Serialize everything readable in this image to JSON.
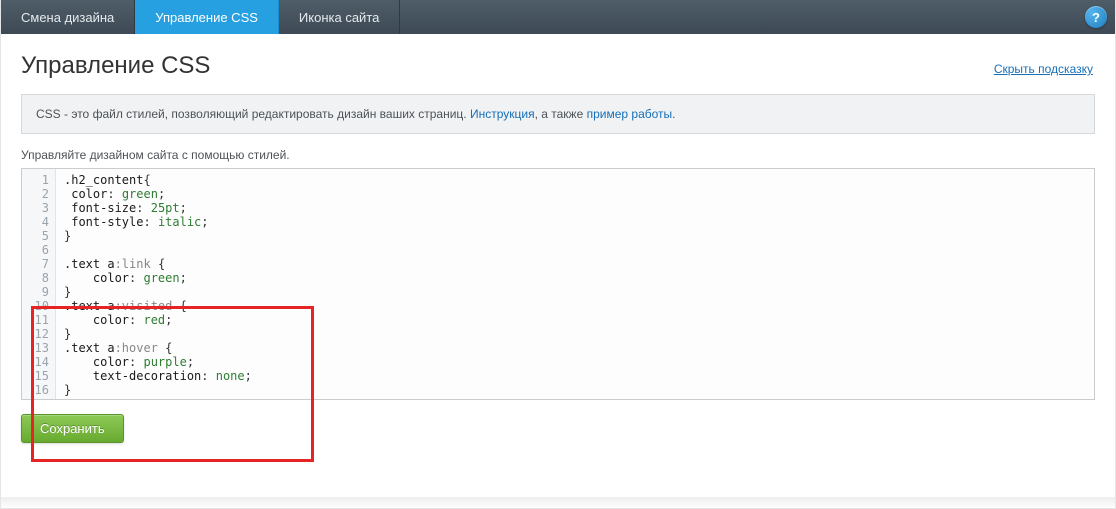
{
  "topnav": {
    "tabs": [
      {
        "label": "Смена дизайна"
      },
      {
        "label": "Управление CSS"
      },
      {
        "label": "Иконка сайта"
      }
    ],
    "help_char": "?"
  },
  "title": "Управление CSS",
  "hide_hint": "Скрыть подсказку",
  "info": {
    "prefix": "CSS - это файл стилей, позволяющий редактировать дизайн ваших страниц. ",
    "link1": "Инструкция",
    "mid": ", а также ",
    "link2": "пример работы",
    "suffix": "."
  },
  "subtitle": "Управляйте дизайном сайта с помощью стилей.",
  "code": {
    "lines": [
      {
        "n": "1",
        "selector": ".h2_content",
        "pseudo": "",
        "brace": "{"
      },
      {
        "n": "2",
        "indent": " ",
        "prop": "color",
        "val": "green",
        "end": ";"
      },
      {
        "n": "3",
        "indent": " ",
        "prop": "font-size",
        "val": "25pt",
        "end": ";"
      },
      {
        "n": "4",
        "indent": " ",
        "prop": "font-style",
        "val": "italic",
        "end": ";"
      },
      {
        "n": "5",
        "brace_close": "}"
      },
      {
        "n": "6",
        "blank": true
      },
      {
        "n": "7",
        "selector": ".text a",
        "pseudo": ":link",
        "space": " ",
        "brace": "{"
      },
      {
        "n": "8",
        "indent": "    ",
        "prop": "color",
        "val": "green",
        "end": ";"
      },
      {
        "n": "9",
        "brace_close": "}"
      },
      {
        "n": "10",
        "selector": ".text a",
        "pseudo": ":visited",
        "space": " ",
        "brace": "{"
      },
      {
        "n": "11",
        "indent": "    ",
        "prop": "color",
        "val": "red",
        "end": ";"
      },
      {
        "n": "12",
        "brace_close": "}"
      },
      {
        "n": "13",
        "selector": ".text a",
        "pseudo": ":hover",
        "space": " ",
        "brace": "{"
      },
      {
        "n": "14",
        "indent": "    ",
        "prop": "color",
        "val": "purple",
        "end": ";"
      },
      {
        "n": "15",
        "indent": "    ",
        "prop": "text-decoration",
        "val": "none",
        "end": ";"
      },
      {
        "n": "16",
        "brace_close": "}"
      }
    ]
  },
  "save_label": "Сохранить"
}
